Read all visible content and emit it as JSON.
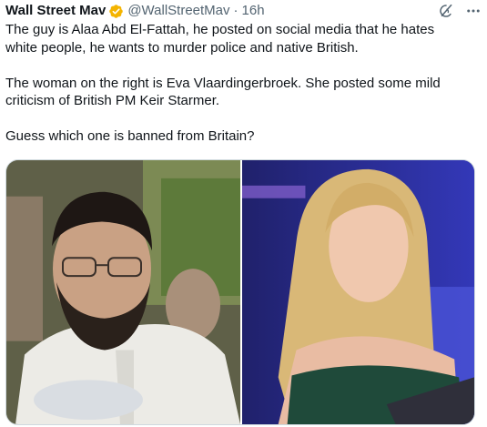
{
  "author": {
    "display_name": "Wall Street Mav",
    "handle": "@WallStreetMav",
    "separator": "·",
    "time": "16h",
    "verified_icon": "verified-badge-icon",
    "verified_color": "#f4b400"
  },
  "actions": {
    "grok_icon": "grok-icon",
    "more_icon": "more-icon"
  },
  "text": {
    "p1": "The guy is Alaa Abd El-Fattah, he posted on social media that he hates white people, he wants to murder police and native British.",
    "p2": "The woman on the right is Eva Vlaardingerbroek. She posted some mild criticism of British PM Keir Starmer.",
    "p3": "Guess which one is banned from Britain?"
  },
  "media": {
    "left_photo": "photo-of-bearded-man",
    "right_photo": "photo-of-blonde-woman-at-podium"
  }
}
